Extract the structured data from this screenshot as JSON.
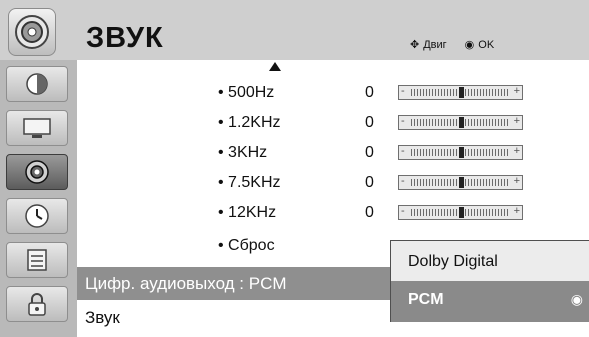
{
  "header": {
    "title": "ЗВУК",
    "hint_move_icon": "✥",
    "hint_move_label": "Двиг",
    "hint_ok_icon": "◉",
    "hint_ok_label": "OK"
  },
  "sidebar": {
    "items": [
      {
        "name": "picture-icon",
        "active": false
      },
      {
        "name": "screen-icon",
        "active": false
      },
      {
        "name": "sound-icon",
        "active": true
      },
      {
        "name": "clock-icon",
        "active": false
      },
      {
        "name": "option-icon",
        "active": false
      },
      {
        "name": "lock-icon",
        "active": false
      }
    ]
  },
  "equalizer": {
    "rows": [
      {
        "label": "• 500Hz",
        "value": "0",
        "level": 0.5
      },
      {
        "label": "• 1.2KHz",
        "value": "0",
        "level": 0.5
      },
      {
        "label": "• 3KHz",
        "value": "0",
        "level": 0.5
      },
      {
        "label": "• 7.5KHz",
        "value": "0",
        "level": 0.5
      },
      {
        "label": "• 12KHz",
        "value": "0",
        "level": 0.5
      }
    ],
    "minus": "-",
    "plus": "+",
    "reset_label": "• Сброс"
  },
  "menu": {
    "digital_out_label": "Цифр. аудиовыход  : PCM",
    "sound_label": "Звук"
  },
  "popup": {
    "options": [
      {
        "label": "Dolby Digital",
        "selected": false
      },
      {
        "label": "PCM",
        "selected": true
      }
    ],
    "selected_mark": "◉"
  },
  "colors": {
    "background": "#c9c9c9",
    "selected": "#8a8a8a",
    "panel": "#ffffff"
  }
}
